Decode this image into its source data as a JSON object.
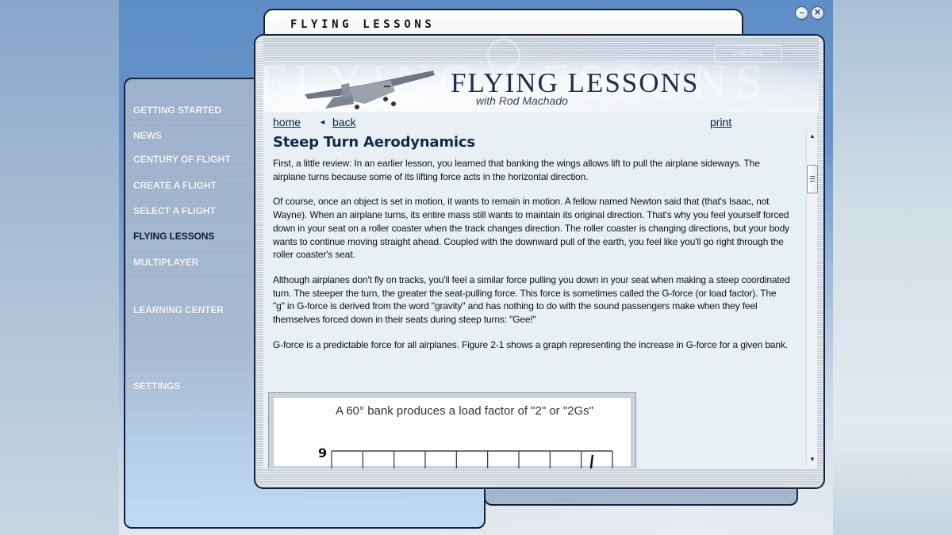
{
  "window": {
    "title_tab": "FLYING LESSONS",
    "controls": [
      {
        "name": "minimize",
        "glyph": "–"
      },
      {
        "name": "close",
        "glyph": "✕"
      }
    ]
  },
  "sidebar": {
    "items": [
      {
        "label": "GETTING STARTED",
        "active": false
      },
      {
        "label": "NEWS",
        "active": false
      },
      {
        "label": "CENTURY OF FLIGHT",
        "active": false
      },
      {
        "label": "CREATE A FLIGHT",
        "active": false
      },
      {
        "label": "SELECT A FLIGHT",
        "active": false
      },
      {
        "label": "FLYING LESSONS",
        "active": true
      },
      {
        "label": "MULTIPLAYER",
        "active": false
      },
      {
        "label": "LEARNING CENTER",
        "active": false
      },
      {
        "label": "SETTINGS",
        "active": false
      }
    ]
  },
  "banner": {
    "title": "FLYING   LESSONS",
    "subtitle": "with Rod Machado",
    "watermark": "FLYING LESSONS",
    "watermark_badge": "CHECKED"
  },
  "toolbar": {
    "home": "home",
    "back_icon": "◄",
    "back": "back",
    "print": "print"
  },
  "article": {
    "title": "Steep Turn Aerodynamics",
    "paragraphs": [
      "First, a little review: In an earlier lesson, you learned that banking the wings allows lift to pull the airplane sideways. The airplane turns because some of its lifting force acts in the horizontal direction.",
      "Of course, once an object is set in motion, it wants to remain in motion. A fellow named Newton said that (that's Isaac, not Wayne). When an airplane turns, its entire mass still wants to maintain its original direction. That's why you feel yourself forced down in your seat on a roller coaster when the track changes direction. The roller coaster is changing directions, but your body wants to continue moving straight ahead. Coupled with the downward pull of the earth, you feel like you'll go right through the roller coaster's seat.",
      "Although airplanes don't fly on tracks, you'll feel a similar force pulling you down in your seat when making a steep coordinated turn. The steeper the turn, the greater the seat-pulling force. This force is sometimes called the G-force (or load factor). The \"g\" in G-force is derived from the word \"gravity\" and has nothing to do with the sound passengers make when they feel themselves forced down in their seats during steep turns: \"Gee!\"",
      "G-force is a predictable force for all airplanes. Figure 2-1 shows a graph representing the increase in G-force for a given bank."
    ],
    "figure": {
      "caption": "A 60° bank produces a load factor of \"2\" or \"2Gs\"",
      "y_top_label": "9",
      "grid_columns": 9
    }
  },
  "scrollbar": {
    "up_glyph": "▲",
    "down_glyph": "▼",
    "position_fraction": 0.08
  },
  "colors": {
    "accent_dark": "#13233f",
    "heading": "#102a4c",
    "nav_active": "#0e1e3a",
    "nav_inactive": "#f4f7fb"
  }
}
